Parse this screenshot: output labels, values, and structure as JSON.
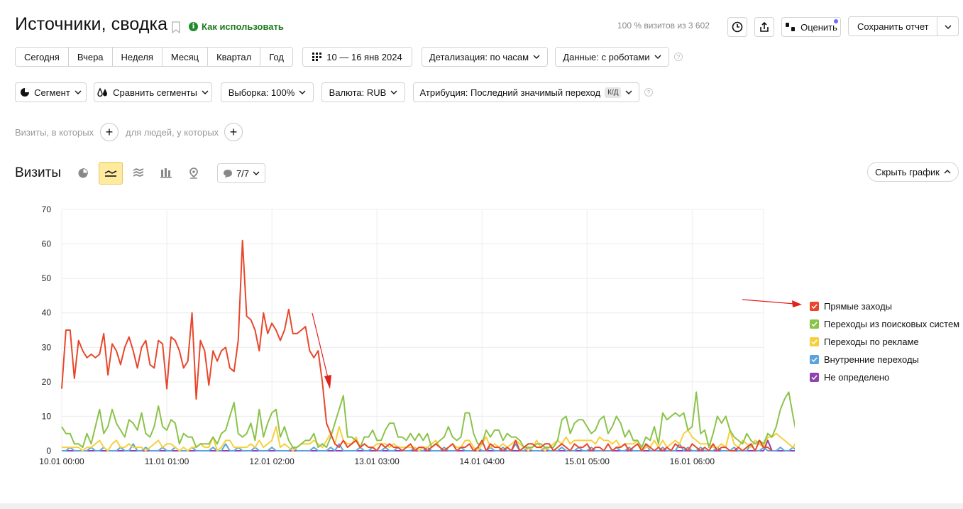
{
  "header": {
    "title": "Источники, сводка",
    "how_to_use": "Как использовать",
    "visits_info": "100 % визитов из 3 602",
    "rate_label": "Оценить",
    "save_report_label": "Сохранить отчет"
  },
  "period_buttons": [
    "Сегодня",
    "Вчера",
    "Неделя",
    "Месяц",
    "Квартал",
    "Год"
  ],
  "date_range": "10 — 16 янв 2024",
  "detail_label": "Детализация: по часам",
  "data_label": "Данные: с роботами",
  "filters": {
    "segment": "Сегмент",
    "compare_segments": "Сравнить сегменты",
    "sample": "Выборка: 100%",
    "currency": "Валюта: RUB",
    "attribution": "Атрибуция: Последний значимый переход",
    "attribution_badge": "К/Д"
  },
  "conditions": {
    "visits_where": "Визиты, в которых",
    "people_where": "для людей, у которых"
  },
  "chart_panel": {
    "metric_label": "Визиты",
    "annotations_label": "7/7",
    "hide_chart_label": "Скрыть график"
  },
  "colors": {
    "direct": "#e8472b",
    "search": "#8bc34a",
    "ads": "#f7cf3d",
    "internal": "#5aa3dc",
    "undefined": "#8e44ad",
    "arrow": "#e3201b"
  },
  "chart_data": {
    "type": "line",
    "ylim": [
      0,
      70
    ],
    "yticks": [
      0,
      10,
      20,
      30,
      40,
      50,
      60,
      70
    ],
    "x_range": [
      "10.01 00:00",
      "16.01 23:00"
    ],
    "xticks": [
      "10.01 00:00",
      "11.01 01:00",
      "12.01 02:00",
      "13.01 03:00",
      "14.01 04:00",
      "15.01 05:00",
      "16.01 06:00"
    ],
    "grid": true,
    "legend_position": "right",
    "series": [
      {
        "name": "Прямые заходы",
        "color": "#e8472b",
        "values": [
          18,
          35,
          35,
          21,
          32,
          29,
          27,
          28,
          27,
          28,
          34,
          22,
          31,
          29,
          25,
          30,
          33,
          29,
          24,
          30,
          32,
          25,
          24,
          32,
          31,
          18,
          33,
          32,
          29,
          24,
          26,
          40,
          15,
          32,
          29,
          19,
          29,
          26,
          29,
          30,
          24,
          23,
          32,
          61,
          39,
          38,
          35,
          29,
          40,
          34,
          37,
          35,
          32,
          35,
          41,
          34,
          34,
          35,
          36,
          29,
          27,
          29,
          20,
          8,
          5,
          2,
          1,
          3,
          1,
          2,
          3,
          1,
          2,
          1,
          1,
          0,
          2,
          1,
          2,
          1,
          1,
          0,
          1,
          2,
          0,
          1,
          1,
          0,
          1,
          2,
          1,
          0,
          1,
          2,
          0,
          1,
          1,
          2,
          0,
          1,
          3,
          0,
          2,
          1,
          1,
          0,
          1,
          0,
          3,
          0,
          1,
          2,
          2,
          1,
          1,
          2,
          2,
          0,
          1,
          2,
          1,
          0,
          2,
          1,
          1,
          2,
          0,
          1,
          1,
          0,
          2,
          0,
          1,
          1,
          2,
          0,
          1,
          2,
          0,
          2,
          1,
          0,
          1,
          0,
          1,
          0,
          2,
          1,
          1,
          0,
          2,
          1,
          0,
          1,
          0,
          2,
          0,
          1,
          1,
          0,
          0,
          1,
          0,
          1,
          2,
          0,
          3,
          1,
          1,
          0
        ]
      },
      {
        "name": "Переходы из поисковых систем",
        "color": "#8bc34a",
        "values": [
          7,
          5,
          5,
          2,
          2,
          1,
          5,
          2,
          7,
          12,
          5,
          7,
          12,
          8,
          6,
          4,
          9,
          8,
          6,
          11,
          5,
          4,
          7,
          13,
          7,
          6,
          9,
          8,
          2,
          5,
          4,
          4,
          1,
          2,
          2,
          2,
          4,
          2,
          5,
          6,
          10,
          14,
          5,
          4,
          5,
          8,
          3,
          12,
          4,
          8,
          11,
          12,
          4,
          7,
          3,
          1,
          1,
          2,
          3,
          3,
          5,
          1,
          2,
          1,
          4,
          8,
          12,
          16,
          4,
          4,
          3,
          1,
          4,
          4,
          6,
          3,
          3,
          6,
          8,
          8,
          4,
          4,
          3,
          5,
          3,
          5,
          3,
          5,
          1,
          2,
          3,
          4,
          7,
          4,
          3,
          4,
          11,
          11,
          5,
          2,
          2,
          6,
          4,
          6,
          6,
          3,
          5,
          4,
          4,
          3,
          1,
          1,
          1,
          2,
          2,
          1,
          1,
          1,
          3,
          9,
          10,
          5,
          8,
          9,
          9,
          7,
          5,
          6,
          9,
          10,
          5,
          7,
          10,
          8,
          4,
          6,
          3,
          3,
          1,
          4,
          3,
          7,
          2,
          11,
          9,
          10,
          11,
          10,
          11,
          6,
          7,
          17,
          5,
          6,
          1,
          5,
          10,
          8,
          10,
          6,
          4,
          3,
          2,
          5,
          3,
          2,
          3,
          2,
          5,
          4,
          7,
          12,
          15,
          17,
          10,
          4,
          7,
          8
        ]
      },
      {
        "name": "Переходы по рекламе",
        "color": "#f7cf3d",
        "values": [
          1,
          1,
          1,
          1,
          1,
          0,
          1,
          1,
          2,
          3,
          1,
          0,
          2,
          3,
          1,
          1,
          2,
          1,
          1,
          1,
          0,
          1,
          2,
          3,
          1,
          2,
          2,
          1,
          0,
          1,
          0,
          1,
          1,
          2,
          1,
          1,
          4,
          0,
          1,
          3,
          3,
          1,
          1,
          1,
          1,
          2,
          1,
          3,
          1,
          2,
          3,
          7,
          1,
          2,
          1,
          0,
          1,
          2,
          2,
          2,
          3,
          2,
          1,
          3,
          5,
          2,
          7,
          3,
          2,
          2,
          4,
          1,
          2,
          1,
          1,
          2,
          2,
          2,
          1,
          2,
          1,
          1,
          1,
          1,
          1,
          0,
          1,
          1,
          2,
          3,
          1,
          0,
          1,
          2,
          1,
          1,
          3,
          3,
          1,
          0,
          2,
          4,
          1,
          2,
          1,
          2,
          1,
          2,
          3,
          2,
          1,
          0,
          1,
          3,
          1,
          0,
          1,
          2,
          3,
          2,
          4,
          2,
          3,
          3,
          3,
          3,
          3,
          2,
          4,
          3,
          3,
          2,
          3,
          1,
          2,
          2,
          2,
          3,
          0,
          1,
          1,
          3,
          1,
          3,
          1,
          2,
          3,
          2,
          5,
          6,
          4,
          3,
          2,
          2,
          2,
          1,
          1,
          2,
          1,
          6,
          2,
          1,
          3,
          2,
          1,
          3,
          2,
          1,
          4,
          4,
          5,
          4,
          3,
          2,
          1,
          3,
          2,
          1
        ]
      },
      {
        "name": "Внутренние переходы",
        "color": "#5aa3dc",
        "values": [
          0,
          0,
          1,
          0,
          0,
          0,
          0,
          1,
          0,
          0,
          1,
          0,
          0,
          0,
          1,
          0,
          0,
          2,
          0,
          0,
          1,
          0,
          0,
          0,
          1,
          0,
          0,
          1,
          0,
          0,
          0,
          1,
          0,
          0,
          0,
          0,
          1,
          0,
          0,
          2,
          0,
          0,
          1,
          0,
          0,
          0,
          1,
          0,
          0,
          0,
          1,
          0,
          0,
          0,
          0,
          1,
          0,
          0,
          0,
          0,
          1,
          0,
          0,
          0,
          1,
          0,
          2,
          0,
          0,
          0,
          0,
          1,
          0,
          0,
          1,
          0,
          0,
          1,
          0,
          0,
          1,
          0,
          0,
          0,
          1,
          0,
          0,
          1,
          0,
          0,
          0,
          1,
          0,
          0,
          0,
          1,
          0,
          0,
          0,
          1,
          0,
          0,
          1,
          0,
          0,
          1,
          0,
          0,
          2,
          0,
          0,
          1,
          0,
          0,
          0,
          1,
          0,
          0,
          0,
          1,
          0,
          0,
          0,
          1,
          0,
          0,
          1,
          0,
          0,
          0,
          0,
          0,
          1,
          0,
          0,
          1,
          0,
          0,
          0,
          2,
          0,
          0,
          0,
          1,
          0,
          0,
          0,
          2,
          0,
          1,
          0,
          0,
          1,
          0,
          0,
          0,
          1,
          0,
          0,
          0,
          1,
          0,
          0,
          0,
          2,
          0,
          0,
          1,
          0,
          0,
          0,
          1,
          0,
          0,
          1,
          0,
          0,
          0
        ]
      },
      {
        "name": "Не определено",
        "color": "#8e44ad",
        "values": [
          0,
          0,
          0,
          0,
          0,
          0,
          0,
          0,
          0,
          0,
          0,
          0,
          0,
          0,
          0,
          0,
          0,
          0,
          0,
          0,
          0,
          0,
          0,
          0,
          0,
          0,
          0,
          0,
          0,
          0,
          0,
          0,
          0,
          0,
          0,
          0,
          0,
          0,
          0,
          0,
          0,
          0,
          0,
          0,
          0,
          0,
          0,
          0,
          0,
          0,
          0,
          0,
          0,
          0,
          0,
          0,
          0,
          0,
          0,
          0,
          0,
          0,
          0,
          0,
          0,
          0,
          0,
          0,
          0,
          0,
          0,
          0,
          0,
          0,
          0,
          0,
          0,
          0,
          0,
          0,
          0,
          0,
          0,
          0,
          0,
          0,
          0,
          0,
          0,
          0,
          0,
          0,
          0,
          0,
          0,
          0,
          0,
          0,
          0,
          0,
          0,
          0,
          0,
          0,
          0,
          0,
          0,
          0,
          0,
          0,
          0,
          0,
          0,
          0,
          0,
          0,
          0,
          0,
          0,
          0,
          0,
          0,
          0,
          0,
          0,
          0,
          0,
          0,
          0,
          0,
          0,
          0,
          0,
          0,
          0,
          0,
          0,
          0,
          0,
          0,
          0,
          0,
          0,
          0,
          0,
          0,
          0,
          0,
          0,
          0,
          0,
          0,
          0,
          0,
          0,
          0,
          0,
          0,
          0,
          0,
          0,
          0,
          0,
          0,
          0,
          0,
          0,
          0,
          3,
          0,
          0,
          0,
          0,
          0,
          0,
          0,
          0,
          0
        ]
      }
    ]
  }
}
